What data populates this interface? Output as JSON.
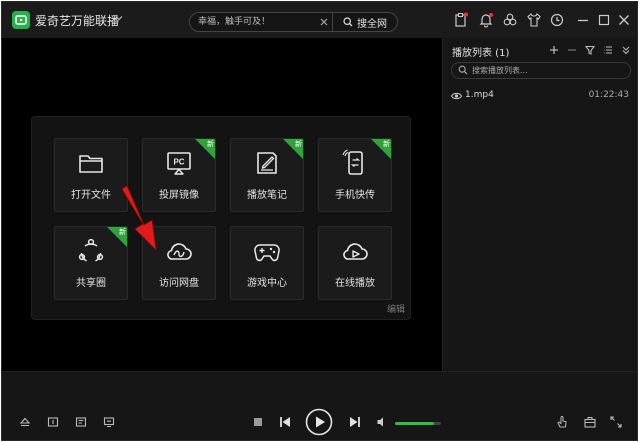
{
  "titlebar": {
    "app_title": "爱奇艺万能联播",
    "search": {
      "placeholder": "幸福，触手可及！",
      "button_label": "搜全网"
    }
  },
  "tiles": [
    {
      "label": "打开文件",
      "icon": "folder-icon",
      "badge": ""
    },
    {
      "label": "投屏镜像",
      "icon": "pc-cast-icon",
      "badge": "新"
    },
    {
      "label": "播放笔记",
      "icon": "note-icon",
      "badge": "新"
    },
    {
      "label": "手机快传",
      "icon": "phone-transfer-icon",
      "badge": "新"
    },
    {
      "label": "共享圈",
      "icon": "share-circle-icon",
      "badge": "新"
    },
    {
      "label": "访问网盘",
      "icon": "cloud-disk-icon",
      "badge": ""
    },
    {
      "label": "游戏中心",
      "icon": "gamepad-icon",
      "badge": ""
    },
    {
      "label": "在线播放",
      "icon": "cloud-play-icon",
      "badge": ""
    }
  ],
  "panel": {
    "edit_label": "编辑"
  },
  "playlist": {
    "title": "播放列表 (1)",
    "search_placeholder": "搜索播放列表...",
    "items": [
      {
        "name": "1.mp4",
        "duration": "01:22:43"
      }
    ]
  },
  "player": {
    "volume": 0.85
  },
  "colors": {
    "accent": "#2fbe44",
    "badge": "#2ea43a",
    "arrow": "#e01b1b"
  }
}
